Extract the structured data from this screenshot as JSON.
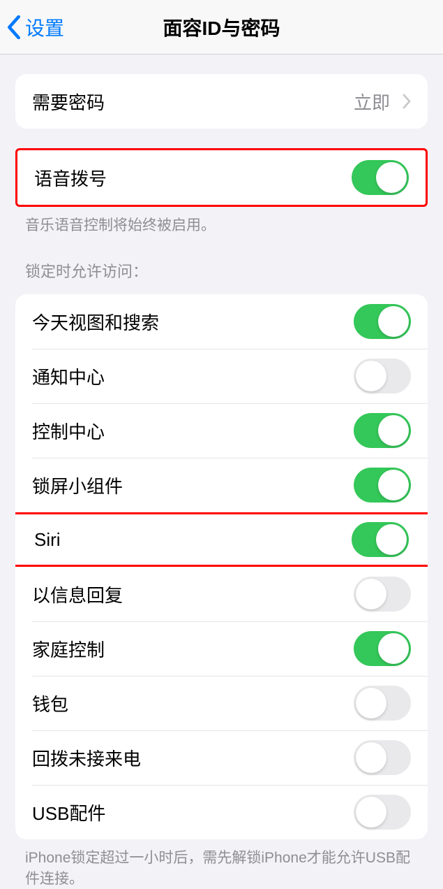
{
  "nav": {
    "back_label": "设置",
    "title": "面容ID与密码"
  },
  "passcode": {
    "label": "需要密码",
    "value": "立即"
  },
  "voice_dial": {
    "label": "语音拨号",
    "on": true,
    "footer": "音乐语音控制将始终被启用。"
  },
  "lock_access": {
    "header": "锁定时允许访问：",
    "items": [
      {
        "label": "今天视图和搜索",
        "on": true
      },
      {
        "label": "通知中心",
        "on": false
      },
      {
        "label": "控制中心",
        "on": true
      },
      {
        "label": "锁屏小组件",
        "on": true
      },
      {
        "label": "Siri",
        "on": true
      },
      {
        "label": "以信息回复",
        "on": false
      },
      {
        "label": "家庭控制",
        "on": true
      },
      {
        "label": "钱包",
        "on": false
      },
      {
        "label": "回拨未接来电",
        "on": false
      },
      {
        "label": "USB配件",
        "on": false
      }
    ],
    "footer": "iPhone锁定超过一小时后，需先解锁iPhone才能允许USB配件连接。"
  }
}
